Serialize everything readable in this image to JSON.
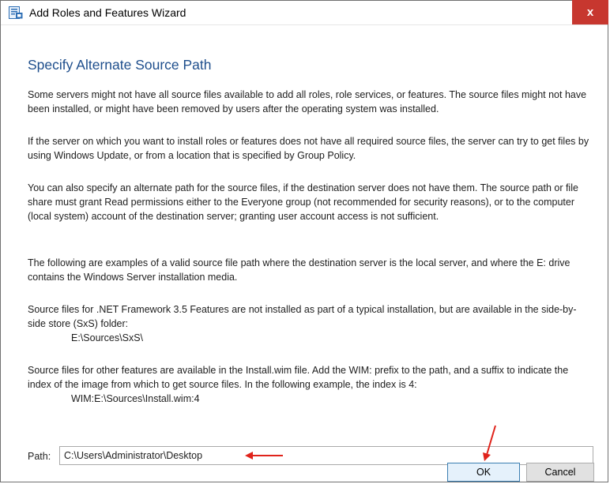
{
  "window": {
    "title": "Add Roles and Features Wizard",
    "close_label": "x"
  },
  "heading": "Specify Alternate Source Path",
  "paragraphs": [
    "Some servers might not have all source files available to add all roles, role services, or features. The source files might not have been installed, or might have been removed by users after the operating system was installed.",
    "If the server on which you want to install roles or features does not have all required source files, the server can try to get files by using Windows Update, or from a location that is specified by Group Policy.",
    "You can also specify an alternate path for the source files, if the destination server does not have them. The source path or file share must grant Read permissions either to the Everyone group (not recommended for security reasons), or to the computer (local system) account of the destination server; granting user account access is not sufficient.",
    "The following are examples of a valid source file path where the destination server is the local server, and where the E: drive contains the Windows Server installation media."
  ],
  "examples": [
    {
      "text": "Source files for .NET Framework 3.5 Features are not installed as part of a typical installation, but are available in the side-by-side store (SxS) folder:",
      "path": "E:\\Sources\\SxS\\"
    },
    {
      "text": "Source files for other features are available in the Install.wim file. Add the WIM: prefix to the path, and a suffix to indicate the index of the image from which to get source files. In the following example, the index is 4:",
      "path": "WIM:E:\\Sources\\Install.wim:4"
    }
  ],
  "path_field": {
    "label": "Path:",
    "value": "C:\\Users\\Administrator\\Desktop"
  },
  "buttons": {
    "ok": "OK",
    "cancel": "Cancel"
  },
  "colors": {
    "heading": "#1e4e8c",
    "close_button": "#c7372f",
    "annotation_arrow": "#e0231b"
  }
}
